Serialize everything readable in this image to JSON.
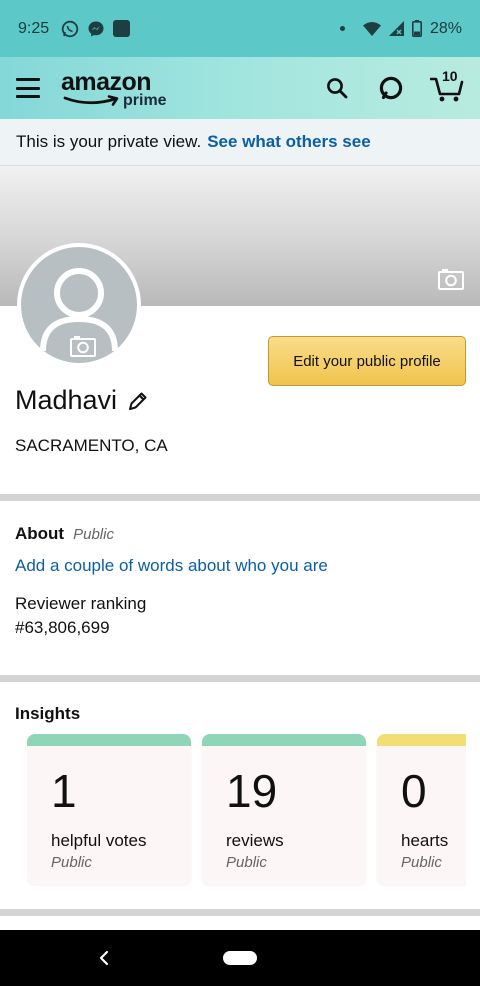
{
  "status_bar": {
    "time": "9:25",
    "battery": "28%",
    "icons": [
      "whatsapp-icon",
      "messenger-icon",
      "app-square-icon",
      "wifi-icon",
      "signal-icon",
      "battery-icon"
    ]
  },
  "header": {
    "logo_text": "amazon",
    "logo_sub": "prime",
    "cart_count": "10",
    "icons": [
      "menu-icon",
      "search-icon",
      "alexa-icon",
      "cart-icon"
    ]
  },
  "private_banner": {
    "text": "This is your private view.",
    "link": "See what others see"
  },
  "profile": {
    "name": "Madhavi",
    "location": "SACRAMENTO, CA",
    "edit_button": "Edit your public profile"
  },
  "about": {
    "title": "About",
    "visibility": "Public",
    "add_link": "Add a couple of words about who you are",
    "ranking_label": "Reviewer ranking",
    "ranking_value": "#63,806,699"
  },
  "insights": {
    "title": "Insights",
    "cards": [
      {
        "value": "1",
        "label": "helpful votes",
        "visibility": "Public",
        "color": "#8fd6b8"
      },
      {
        "value": "19",
        "label": "reviews",
        "visibility": "Public",
        "color": "#8fd6b8"
      },
      {
        "value": "0",
        "label": "hearts",
        "visibility": "Public",
        "color": "#f3de74"
      }
    ]
  },
  "colors": {
    "status_bar": "#5cc8c8",
    "link": "#0b5fa5",
    "button": "#f1c44d"
  }
}
